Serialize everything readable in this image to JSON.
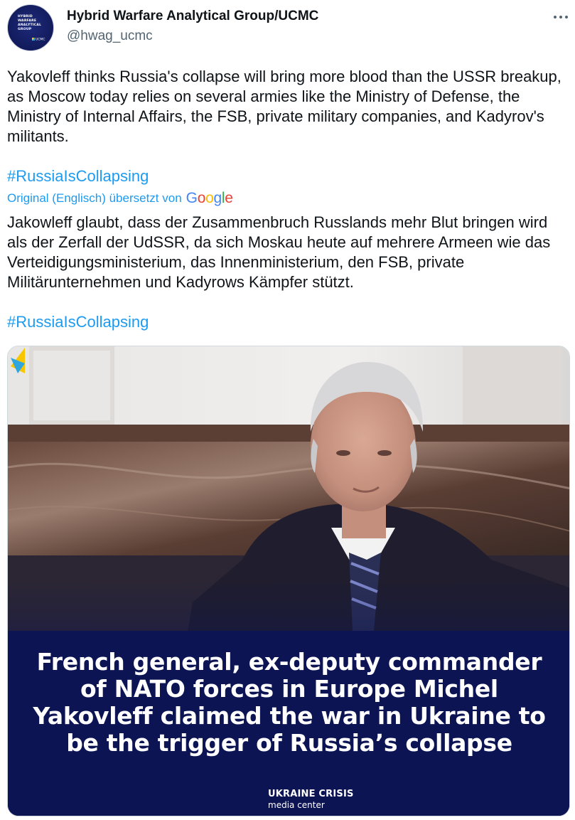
{
  "tweet": {
    "display_name": "Hybrid Warfare Analytical Group/UCMC",
    "handle": "@hwag_ucmc",
    "avatar": {
      "text": "HYBRID\nWARFARE\nANALYTICAL\nGROUP",
      "mark": "UCMC"
    },
    "more_icon": "more-horizontal-icon",
    "text_original": "Yakovleff thinks Russia's collapse will bring more blood than the USSR breakup, as Moscow today relies on several armies like the Ministry of Defense, the Ministry of Internal Affairs, the FSB, private military companies, and Kadyrov's militants.",
    "hashtag": "#RussiaIsCollapsing",
    "translation": {
      "label": "Original (Englisch) übersetzt von",
      "provider_logo": "Google",
      "text": "Jakowleff glaubt, dass der Zusammenbruch Russlands mehr Blut bringen wird als der Zerfall der UdSSR, da sich Moskau heute auf mehrere Armeen wie das Verteidigungsministerium, das Innenministerium, den FSB, private Militärunternehmen und Kadyrows Kämpfer stützt.",
      "hashtag": "#RussiaIsCollapsing"
    },
    "media": {
      "caption": "French general, ex-deputy commander of NATO forces in Europe Michel Yakovleff claimed the war in Ukraine to be the trigger of Russia’s collapse",
      "logo_name": "UKRAINE CRISIS",
      "logo_sub": "media center"
    }
  },
  "colors": {
    "text": "#0f1419",
    "secondary": "#536471",
    "link": "#1d9bf0",
    "media_banner": "#0d1454"
  }
}
